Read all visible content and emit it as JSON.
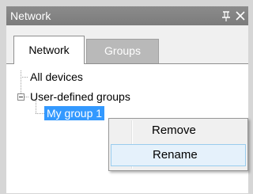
{
  "panel": {
    "title": "Network",
    "pin_icon": "pin-icon",
    "close_icon": "close-icon"
  },
  "tabs": [
    {
      "label": "Network",
      "active": true
    },
    {
      "label": "Groups",
      "active": false
    }
  ],
  "tree": {
    "nodes": [
      {
        "label": "All devices",
        "level": 0,
        "expandable": false
      },
      {
        "label": "User-defined groups",
        "level": 0,
        "expandable": true,
        "expanded": true
      },
      {
        "label": "My group 1",
        "level": 1,
        "selected": true
      }
    ]
  },
  "context_menu": {
    "items": [
      {
        "label": "Remove",
        "highlighted": false
      },
      {
        "label": "Rename",
        "highlighted": true
      }
    ]
  },
  "colors": {
    "titlebar": "#7c7c7c",
    "selection": "#3399ff",
    "menu_highlight": "#e5f1fb",
    "menu_highlight_border": "#99ccee"
  }
}
